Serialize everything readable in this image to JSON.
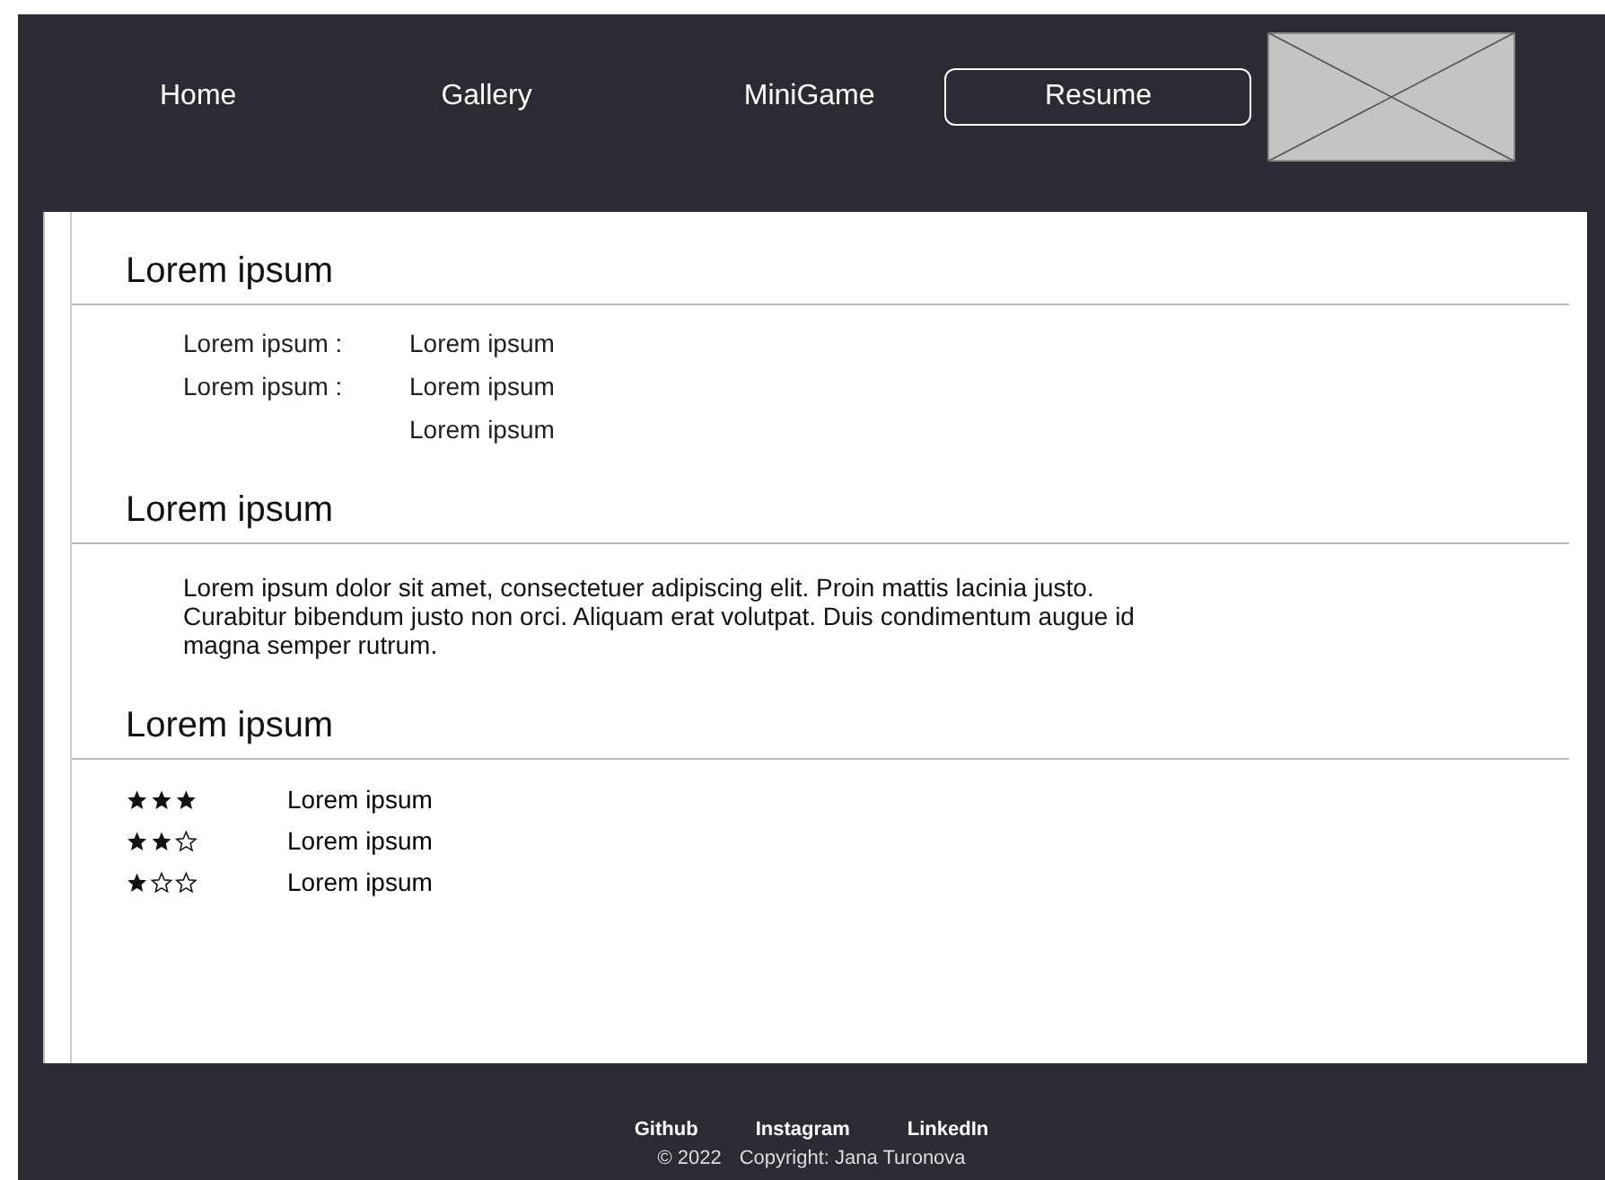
{
  "nav": {
    "items": [
      {
        "label": "Home",
        "selected": false
      },
      {
        "label": "Gallery",
        "selected": false
      },
      {
        "label": "MiniGame",
        "selected": false
      },
      {
        "label": "Resume",
        "selected": true
      }
    ],
    "logo": {
      "kind": "placeholder"
    }
  },
  "sections": [
    {
      "kind": "details",
      "title": "Lorem ipsum",
      "rows": [
        {
          "label": "Lorem ipsum :",
          "values": [
            "Lorem ipsum"
          ]
        },
        {
          "label": "Lorem ipsum :",
          "values": [
            "Lorem ipsum",
            "Lorem ipsum"
          ]
        }
      ]
    },
    {
      "kind": "text",
      "title": "Lorem ipsum",
      "paragraph": "Lorem ipsum dolor sit amet, consectetuer adipiscing elit. Proin mattis lacinia justo. Curabitur bibendum justo non orci. Aliquam erat volutpat. Duis condimentum augue id magna semper rutrum."
    },
    {
      "kind": "skills",
      "title": "Lorem ipsum",
      "skills": [
        {
          "stars": 3,
          "label": "Lorem ipsum"
        },
        {
          "stars": 2,
          "label": "Lorem ipsum"
        },
        {
          "stars": 1,
          "label": "Lorem ipsum"
        }
      ]
    }
  ],
  "footer": {
    "links": [
      "Github",
      "Instagram",
      "LinkedIn"
    ],
    "year": "© 2022",
    "copyright": "Copyright: Jana Turonova"
  }
}
